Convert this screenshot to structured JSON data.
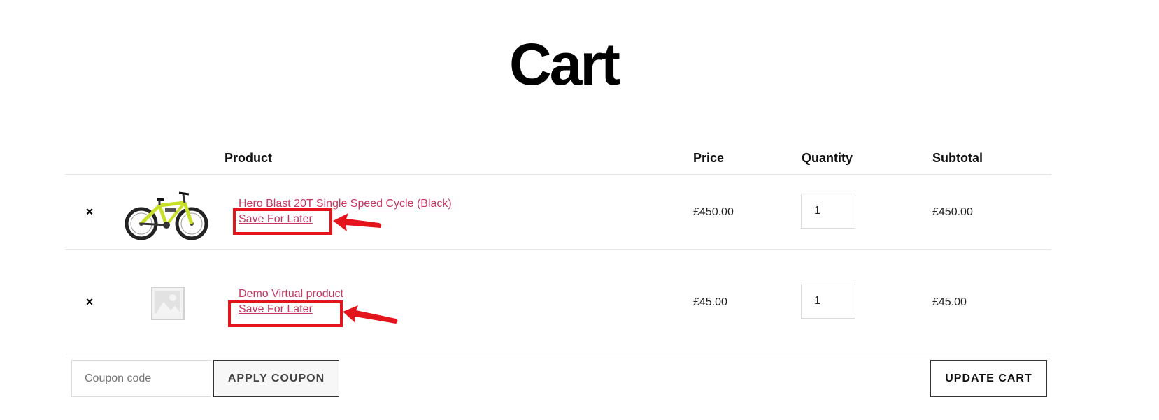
{
  "page": {
    "title": "Cart"
  },
  "table": {
    "headers": {
      "product": "Product",
      "price": "Price",
      "quantity": "Quantity",
      "subtotal": "Subtotal"
    },
    "rows": [
      {
        "remove_symbol": "×",
        "thumbnail": "bicycle-product-image",
        "name": "Hero Blast 20T Single Speed Cycle (Black)",
        "save_for_later": "Save For Later",
        "price": "£450.00",
        "quantity": "1",
        "subtotal": "£450.00"
      },
      {
        "remove_symbol": "×",
        "thumbnail": "placeholder-image-icon",
        "name": "Demo Virtual product",
        "save_for_later": "Save For Later",
        "price": "£45.00",
        "quantity": "1",
        "subtotal": "£45.00"
      }
    ]
  },
  "actions": {
    "coupon_placeholder": "Coupon code",
    "apply_coupon": "APPLY COUPON",
    "update_cart": "UPDATE CART"
  },
  "colors": {
    "link": "#c63763",
    "annotation": "#e3141b"
  }
}
